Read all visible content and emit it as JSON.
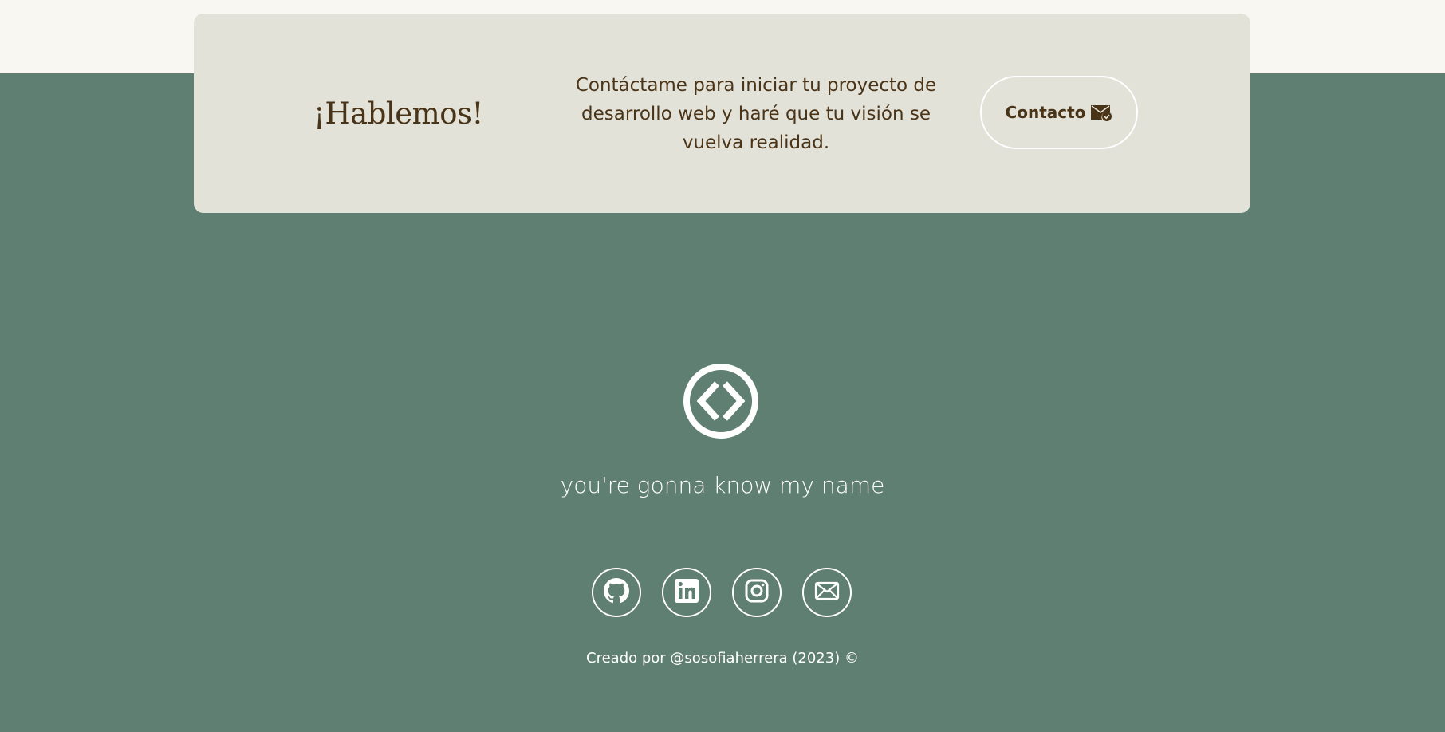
{
  "cta": {
    "title": "¡Hablemos!",
    "text": "Contáctame para iniciar tu proyecto de desarrollo web y haré que tu visión se vuelva realidad.",
    "button_label": "Contacto",
    "button_icon": "mail-check-icon"
  },
  "footer": {
    "logo_icon": "code-circle-icon",
    "tagline": "you're gonna know my name",
    "social": [
      {
        "icon": "github-icon"
      },
      {
        "icon": "linkedin-icon"
      },
      {
        "icon": "instagram-icon"
      },
      {
        "icon": "email-icon"
      }
    ],
    "credit": "Creado por @sosofiaherrera (2023) ©"
  },
  "colors": {
    "background_top": "#f8f7f2",
    "background_footer": "#5f7f72",
    "card": "#e3e2d9",
    "text_brown": "#4a3418",
    "white": "#ffffff"
  }
}
